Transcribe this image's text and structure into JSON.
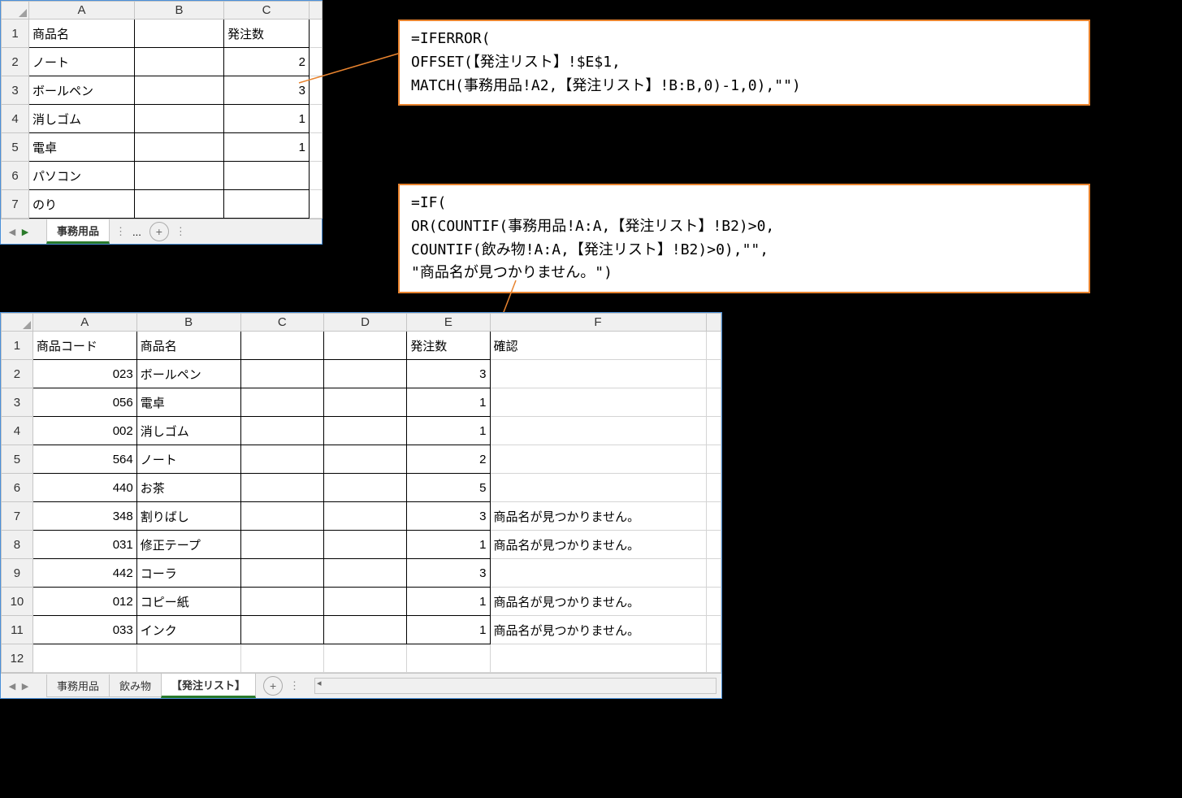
{
  "panel1": {
    "cols": [
      "A",
      "B",
      "C"
    ],
    "rows": [
      "1",
      "2",
      "3",
      "4",
      "5",
      "6",
      "7"
    ],
    "data": [
      {
        "a": "商品名",
        "b": "",
        "c": "発注数"
      },
      {
        "a": "ノート",
        "b": "",
        "c": "2"
      },
      {
        "a": "ボールペン",
        "b": "",
        "c": "3"
      },
      {
        "a": "消しゴム",
        "b": "",
        "c": "1"
      },
      {
        "a": "電卓",
        "b": "",
        "c": "1"
      },
      {
        "a": "パソコン",
        "b": "",
        "c": ""
      },
      {
        "a": "のり",
        "b": "",
        "c": ""
      }
    ],
    "tabs": {
      "active": "事務用品",
      "ellipsis": "..."
    }
  },
  "panel2": {
    "cols": [
      "A",
      "B",
      "C",
      "D",
      "E",
      "F"
    ],
    "rows": [
      "1",
      "2",
      "3",
      "4",
      "5",
      "6",
      "7",
      "8",
      "9",
      "10",
      "11",
      "12"
    ],
    "data": [
      {
        "a": "商品コード",
        "b": "商品名",
        "c": "",
        "d": "",
        "e": "発注数",
        "f": "確認"
      },
      {
        "a": "023",
        "b": "ボールペン",
        "c": "",
        "d": "",
        "e": "3",
        "f": ""
      },
      {
        "a": "056",
        "b": "電卓",
        "c": "",
        "d": "",
        "e": "1",
        "f": ""
      },
      {
        "a": "002",
        "b": "消しゴム",
        "c": "",
        "d": "",
        "e": "1",
        "f": ""
      },
      {
        "a": "564",
        "b": "ノート",
        "c": "",
        "d": "",
        "e": "2",
        "f": ""
      },
      {
        "a": "440",
        "b": "お茶",
        "c": "",
        "d": "",
        "e": "5",
        "f": ""
      },
      {
        "a": "348",
        "b": "割りばし",
        "c": "",
        "d": "",
        "e": "3",
        "f": "商品名が見つかりません。"
      },
      {
        "a": "031",
        "b": "修正テープ",
        "c": "",
        "d": "",
        "e": "1",
        "f": "商品名が見つかりません。"
      },
      {
        "a": "442",
        "b": "コーラ",
        "c": "",
        "d": "",
        "e": "3",
        "f": ""
      },
      {
        "a": "012",
        "b": "コピー紙",
        "c": "",
        "d": "",
        "e": "1",
        "f": "商品名が見つかりません。"
      },
      {
        "a": "033",
        "b": "インク",
        "c": "",
        "d": "",
        "e": "1",
        "f": "商品名が見つかりません。"
      },
      {
        "a": "",
        "b": "",
        "c": "",
        "d": "",
        "e": "",
        "f": ""
      }
    ],
    "tabs": {
      "t1": "事務用品",
      "t2": "飲み物",
      "t3": "【発注リスト】"
    }
  },
  "callout1": "=IFERROR(\nOFFSET(【発注リスト】!$E$1,\nMATCH(事務用品!A2,【発注リスト】!B:B,0)-1,0),\"\")",
  "callout2": "=IF(\nOR(COUNTIF(事務用品!A:A,【発注リスト】!B2)>0,\nCOUNTIF(飲み物!A:A,【発注リスト】!B2)>0),\"\",\n\"商品名が見つかりません。\")"
}
